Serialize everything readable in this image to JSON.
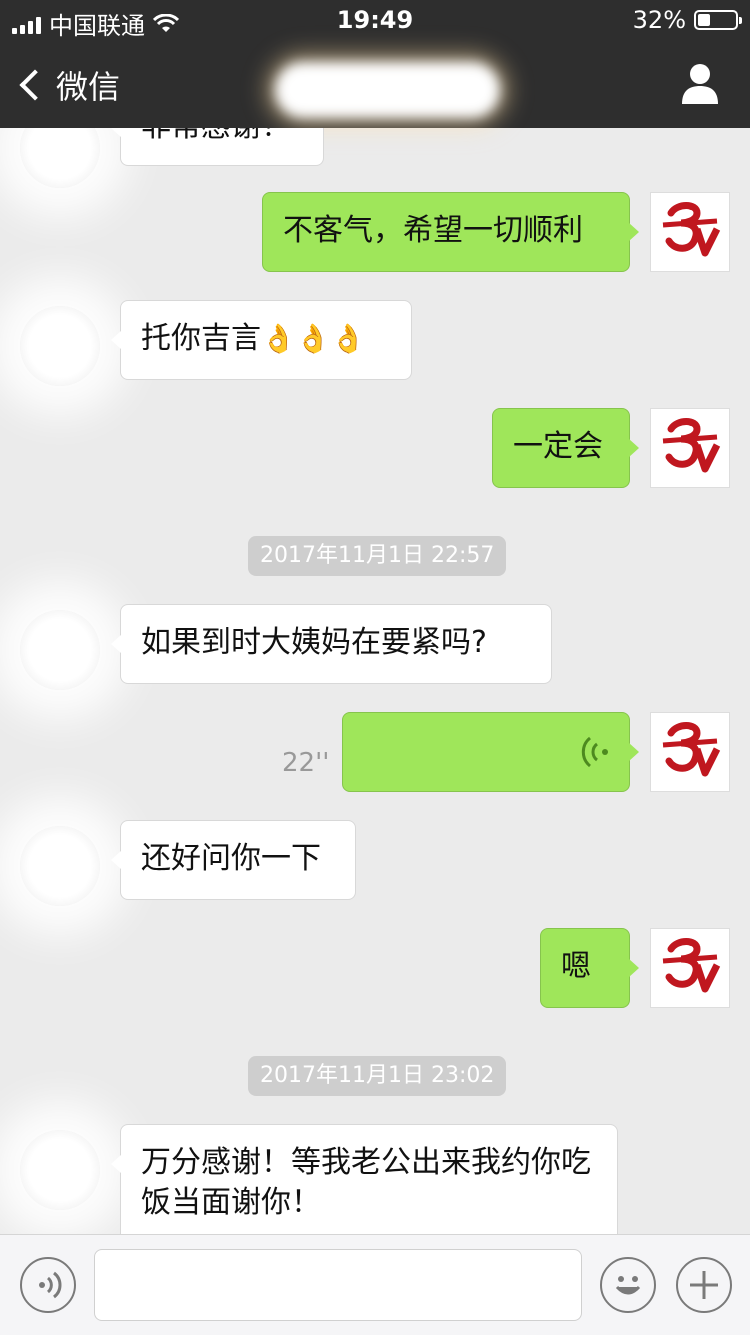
{
  "status_bar": {
    "carrier": "中国联通",
    "time": "19:49",
    "battery_percent": "32%",
    "battery_level": 0.32,
    "signal_icon": "cellular-signal-icon",
    "wifi_icon": "wifi-icon"
  },
  "nav": {
    "back_label": "微信",
    "back_icon": "chevron-left-icon",
    "profile_icon": "person-icon"
  },
  "messages": {
    "m0": "非常感谢！",
    "m1": "不客气，希望一切顺利",
    "m2": "托你吉言",
    "m2_emoji": "👌👌👌",
    "m3": "一定会",
    "ts1": "2017年11月1日 22:57",
    "m4": "如果到时大姨妈在要紧吗?",
    "m5_duration": "22''",
    "m6": "还好问你一下",
    "m7": "嗯",
    "ts2": "2017年11月1日 23:02",
    "m8": "万分感谢！等我老公出来我约你吃饭当面谢你！"
  },
  "input_bar": {
    "voice_icon": "voice-input-icon",
    "emoji_icon": "emoji-icon",
    "add_icon": "plus-icon",
    "text_value": ""
  },
  "colors": {
    "nav_bg": "#2e2e2e",
    "chat_bg": "#ebebeb",
    "sent_bubble": "#9fe65a",
    "received_bubble": "#ffffff",
    "avatar_red": "#c0171f"
  }
}
